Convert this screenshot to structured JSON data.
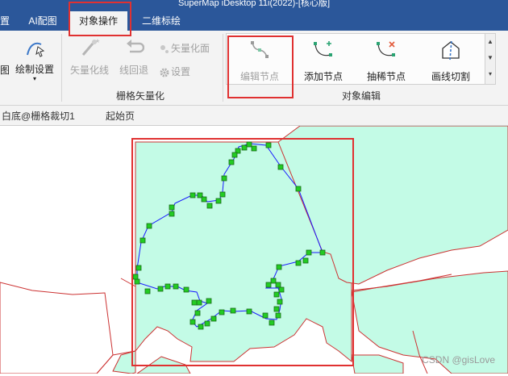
{
  "window": {
    "title": "SuperMap iDesktop 11i(2022)-[核心版]"
  },
  "tabs": [
    {
      "label": "置",
      "active": false
    },
    {
      "label": "AI配图",
      "active": false
    },
    {
      "label": "对象操作",
      "active": true
    },
    {
      "label": "二维标绘",
      "active": false
    }
  ],
  "ribbon": {
    "left_partial": {
      "map_label": "图",
      "draw_settings": "绘制设置"
    },
    "raster_group": {
      "label": "栅格矢量化",
      "vectorize_line": "矢量化线",
      "line_rollback": "线回退",
      "vectorize_face": "矢量化面",
      "settings": "设置"
    },
    "edit_group": {
      "label": "对象编辑",
      "edit_nodes": "编辑节点",
      "add_nodes": "添加节点",
      "thin_nodes": "抽稀节点",
      "line_split": "画线切割"
    }
  },
  "doc_tabs": [
    {
      "label": "白底@栅格裁切1"
    },
    {
      "label": "起始页"
    }
  ],
  "watermark": "CSDN @gisLove",
  "colors": {
    "accent": "#2b579a",
    "highlight": "#e03131",
    "polygon_fill": "#c3fbe6",
    "node": "#22cc22",
    "boundary": "#cc3333",
    "edit_line": "#1a1aff"
  }
}
